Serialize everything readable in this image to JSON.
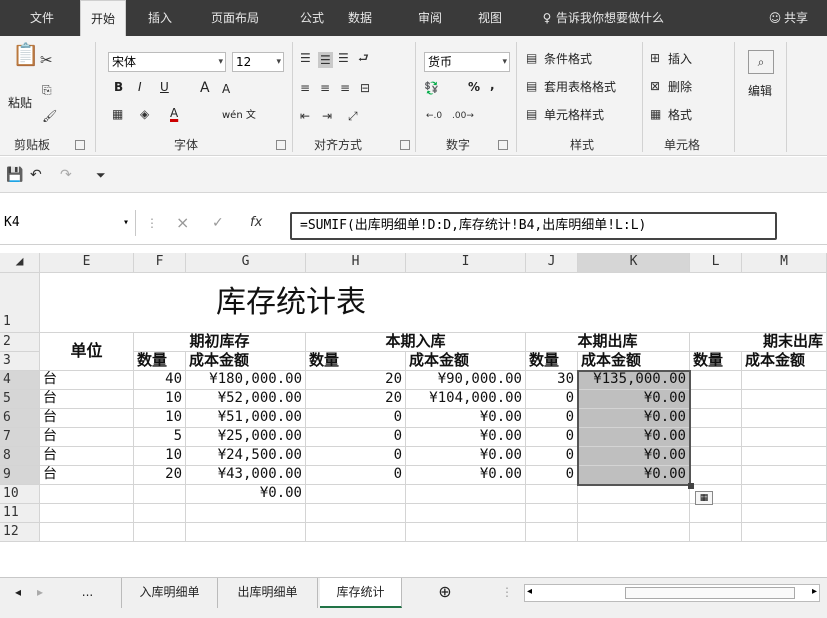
{
  "tabs": {
    "file": "文件",
    "home": "开始",
    "insert": "插入",
    "layout": "页面布局",
    "formulas": "公式",
    "data": "数据",
    "review": "审阅",
    "view": "视图",
    "tell": "告诉我你想要做什么",
    "share": "共享"
  },
  "ribbon": {
    "clipboard": {
      "paste": "粘贴",
      "label": "剪贴板"
    },
    "font": {
      "name": "宋体",
      "size": "12",
      "label": "字体",
      "bold": "B",
      "italic": "I",
      "underline": "U",
      "grow": "A",
      "shrink": "A",
      "wen": "wén 文"
    },
    "align": {
      "label": "对齐方式"
    },
    "number": {
      "format": "货币",
      "label": "数字",
      "pct": "%",
      "comma": ","
    },
    "styles": {
      "cond": "条件格式",
      "table": "套用表格格式",
      "cell": "单元格样式",
      "label": "样式"
    },
    "cells": {
      "insert": "插入",
      "delete": "删除",
      "format": "格式",
      "label": "单元格"
    },
    "edit": {
      "label": "编辑"
    }
  },
  "formula_bar": {
    "cell_ref": "K4",
    "fx": "fx",
    "formula": "=SUMIF(出库明细单!D:D,库存统计!B4,出库明细单!L:L)"
  },
  "columns": [
    "E",
    "F",
    "G",
    "H",
    "I",
    "J",
    "K",
    "L",
    "M"
  ],
  "rows": [
    "1",
    "2",
    "3",
    "4",
    "5",
    "6",
    "7",
    "8",
    "9",
    "10",
    "11",
    "12"
  ],
  "sheet": {
    "title": "库存统计表",
    "unit_header": "单位",
    "groups": [
      "期初库存",
      "本期入库",
      "本期出库",
      "期末出库"
    ],
    "sub": {
      "qty": "数量",
      "amount": "成本金额",
      "amount_cut": "成本金额"
    },
    "data": [
      [
        "台",
        "40",
        "¥180,000.00",
        "20",
        "¥90,000.00",
        "30",
        "¥135,000.00"
      ],
      [
        "台",
        "10",
        "¥52,000.00",
        "20",
        "¥104,000.00",
        "0",
        "¥0.00"
      ],
      [
        "台",
        "10",
        "¥51,000.00",
        "0",
        "¥0.00",
        "0",
        "¥0.00"
      ],
      [
        "台",
        "5",
        "¥25,000.00",
        "0",
        "¥0.00",
        "0",
        "¥0.00"
      ],
      [
        "台",
        "10",
        "¥24,500.00",
        "0",
        "¥0.00",
        "0",
        "¥0.00"
      ],
      [
        "台",
        "20",
        "¥43,000.00",
        "0",
        "¥0.00",
        "0",
        "¥0.00"
      ]
    ],
    "row10_g": "¥0.00"
  },
  "sheet_tabs": {
    "more": "...",
    "tab1": "入库明细单",
    "tab2": "出库明细单",
    "tab3": "库存统计"
  }
}
